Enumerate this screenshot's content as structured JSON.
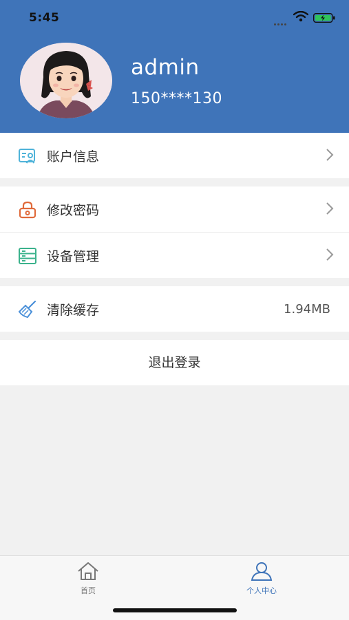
{
  "status_bar": {
    "time": "5:45"
  },
  "profile": {
    "username": "admin",
    "phone": "150****130"
  },
  "menu": {
    "account_info": "账户信息",
    "change_password": "修改密码",
    "device_management": "设备管理",
    "clear_cache": "清除缓存",
    "cache_size": "1.94MB",
    "logout": "退出登录"
  },
  "tabbar": {
    "tabs": [
      {
        "label": "首页",
        "active": false
      },
      {
        "label": "个人中心",
        "active": true
      }
    ]
  },
  "colors": {
    "header_bg": "#3f74b9",
    "active_tab": "#3f74b9",
    "inactive_tab": "#777777",
    "account_icon": "#4fb3d9",
    "password_icon": "#e06a3b",
    "device_icon": "#3bb28c",
    "cache_icon": "#4a90d9"
  }
}
